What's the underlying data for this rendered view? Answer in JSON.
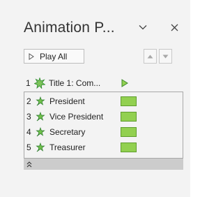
{
  "pane": {
    "title": "Animation P...",
    "play_all_label": "Play All"
  },
  "effects": [
    {
      "number": "1",
      "name": "Title 1: Com...",
      "icon": "entrance-burst-icon",
      "trigger": "play-trigger-icon"
    },
    {
      "number": "2",
      "name": "President",
      "icon": "emphasis-star-icon",
      "timing": "bar"
    },
    {
      "number": "3",
      "name": "Vice President",
      "icon": "emphasis-star-icon",
      "timing": "bar"
    },
    {
      "number": "4",
      "name": "Secretary",
      "icon": "emphasis-star-icon",
      "timing": "bar"
    },
    {
      "number": "5",
      "name": "Treasurer",
      "icon": "emphasis-star-icon",
      "timing": "bar"
    }
  ],
  "colors": {
    "timing_bar": "#92d050",
    "timing_bar_border": "#5f9d2e",
    "icon_green": "#3a9c3a",
    "collapse_bar": "#cccccc"
  },
  "icons": {
    "dropdown": "chevron-down-icon",
    "close": "close-icon",
    "play": "play-icon",
    "move_up": "triangle-up-icon",
    "move_down": "triangle-down-icon",
    "collapse": "double-chevron-up-icon"
  }
}
